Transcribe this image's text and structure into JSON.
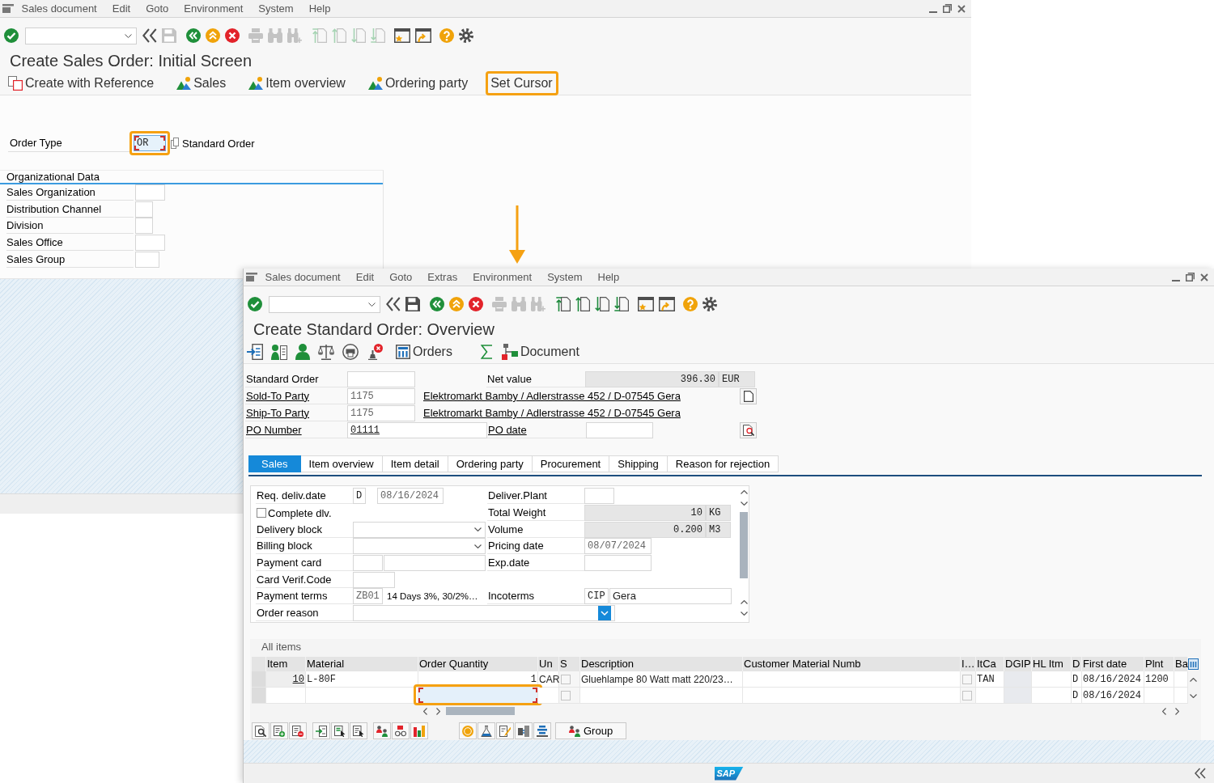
{
  "initial_window": {
    "menu": [
      "Sales document",
      "Edit",
      "Goto",
      "Environment",
      "System",
      "Help"
    ],
    "toolbar": [
      {
        "kind": "enter",
        "disabled": false
      },
      {
        "kind": "collapse",
        "disabled": false
      },
      {
        "kind": "save",
        "disabled": true
      },
      {
        "kind": "back",
        "disabled": false
      },
      {
        "kind": "exit",
        "disabled": false
      },
      {
        "kind": "cancel",
        "disabled": false
      },
      {
        "kind": "print",
        "disabled": true
      },
      {
        "kind": "find",
        "disabled": true
      },
      {
        "kind": "find_next",
        "disabled": true
      },
      {
        "kind": "first_page",
        "disabled": true
      },
      {
        "kind": "previous_page",
        "disabled": true
      },
      {
        "kind": "next_page",
        "disabled": true
      },
      {
        "kind": "last_page",
        "disabled": true
      },
      {
        "kind": "new_session",
        "disabled": false
      },
      {
        "kind": "shortcut",
        "disabled": false
      },
      {
        "kind": "help",
        "disabled": false
      },
      {
        "kind": "settings",
        "disabled": false
      }
    ],
    "title": "Create Sales Order: Initial Screen",
    "app_toolbar": [
      {
        "kind": "reference",
        "label": "Create with Reference",
        "highlighted": false
      },
      {
        "kind": "screen",
        "label": "Sales",
        "highlighted": false
      },
      {
        "kind": "screen",
        "label": "Item overview",
        "highlighted": false
      },
      {
        "kind": "screen",
        "label": "Ordering party",
        "highlighted": false
      },
      {
        "kind": "text",
        "label": "Set Cursor",
        "highlighted": true
      }
    ],
    "order_type": {
      "label": "Order Type",
      "value": "OR",
      "focused": true,
      "highlighted": true,
      "description": "Standard Order"
    },
    "org_data": {
      "title": "Organizational Data",
      "fields": [
        {
          "label": "Sales Organization"
        },
        {
          "label": "Distribution Channel"
        },
        {
          "label": "Division"
        },
        {
          "label": "Sales Office"
        },
        {
          "label": "Sales Group"
        }
      ]
    }
  },
  "overview_window": {
    "menu": [
      "Sales document",
      "Edit",
      "Goto",
      "Extras",
      "Environment",
      "System",
      "Help"
    ],
    "toolbar": [
      {
        "kind": "enter",
        "disabled": false
      },
      {
        "kind": "collapse",
        "disabled": false
      },
      {
        "kind": "save",
        "disabled": false
      },
      {
        "kind": "back",
        "disabled": false
      },
      {
        "kind": "exit",
        "disabled": false
      },
      {
        "kind": "cancel",
        "disabled": false
      },
      {
        "kind": "print",
        "disabled": true
      },
      {
        "kind": "find",
        "disabled": true
      },
      {
        "kind": "find_next",
        "disabled": true
      },
      {
        "kind": "first_page",
        "disabled": false
      },
      {
        "kind": "previous_page",
        "disabled": false
      },
      {
        "kind": "next_page",
        "disabled": false
      },
      {
        "kind": "last_page",
        "disabled": false
      },
      {
        "kind": "new_session",
        "disabled": false
      },
      {
        "kind": "shortcut",
        "disabled": false
      },
      {
        "kind": "help",
        "disabled": false
      },
      {
        "kind": "settings",
        "disabled": false
      }
    ],
    "title": "Create Standard Order: Overview",
    "app_toolbar": [
      {
        "kind": "header"
      },
      {
        "kind": "partner_list"
      },
      {
        "kind": "person"
      },
      {
        "kind": "scale"
      },
      {
        "kind": "print_preview"
      },
      {
        "kind": "stamp_cancel"
      },
      {
        "kind": "table",
        "label": "Orders"
      },
      {
        "kind": "sigma"
      },
      {
        "kind": "flow",
        "label": "Document"
      }
    ],
    "header": {
      "order": {
        "label": "Standard Order"
      },
      "net_value": {
        "label": "Net value",
        "value": "396.30",
        "currency": "EUR"
      },
      "parties": [
        {
          "label": "Sold-To Party",
          "number": "1175",
          "address": "Elektromarkt Bamby / Adlerstrasse 452 / D-07545 Gera"
        },
        {
          "label": "Ship-To Party",
          "number": "1175",
          "address": "Elektromarkt Bamby / Adlerstrasse 452 / D-07545 Gera"
        }
      ],
      "po_number": {
        "label": "PO Number",
        "value": "01111"
      },
      "po_date": {
        "label": "PO date"
      }
    },
    "tabs": [
      {
        "label": "Sales",
        "selected": true
      },
      {
        "label": "Item overview",
        "selected": false
      },
      {
        "label": "Item detail",
        "selected": false
      },
      {
        "label": "Ordering party",
        "selected": false
      },
      {
        "label": "Procurement",
        "selected": false
      },
      {
        "label": "Shipping",
        "selected": false
      },
      {
        "label": "Reason for rejection",
        "selected": false
      }
    ],
    "sales_tab": {
      "rows": [
        {
          "left": {
            "kind": "date",
            "label": "Req. deliv.date",
            "code": "D",
            "value": "08/16/2024"
          },
          "right": {
            "kind": "input",
            "label": "Deliver.Plant"
          }
        },
        {
          "left": {
            "kind": "checkbox",
            "label": "Complete dlv.",
            "checked": false
          },
          "right": {
            "kind": "quantity",
            "label": "Total Weight",
            "value": "10",
            "unit": "KG"
          }
        },
        {
          "left": {
            "kind": "dropdown",
            "label": "Delivery block",
            "focused": false
          },
          "right": {
            "kind": "quantity",
            "label": "Volume",
            "value": "0.200",
            "unit": "M3"
          }
        },
        {
          "left": {
            "kind": "dropdown",
            "label": "Billing block",
            "focused": false
          },
          "right": {
            "kind": "input",
            "label": "Pricing date",
            "value": "08/07/2024"
          }
        },
        {
          "left": {
            "kind": "pair",
            "label": "Payment card"
          },
          "right": {
            "kind": "input",
            "label": "Exp.date"
          }
        },
        {
          "left": {
            "kind": "input",
            "label": "Card Verif.Code"
          }
        },
        {
          "left": {
            "kind": "code_text",
            "label": "Payment terms",
            "code": "ZB01",
            "text": "14 Days 3%, 30/2%…"
          },
          "right": {
            "kind": "pair",
            "label": "Incoterms",
            "values": [
              "CIP",
              "Gera"
            ]
          }
        },
        {
          "left": {
            "kind": "dropdown",
            "label": "Order reason",
            "focused": true
          }
        }
      ]
    },
    "items": {
      "title": "All items",
      "columns": [
        "Item",
        "Material",
        "Order Quantity",
        "Un",
        "S",
        "Description",
        "Customer Material Numb",
        "I…",
        "ItCa",
        "DGIP",
        "HL Itm",
        "D",
        "First date",
        "Plnt",
        "Ba"
      ],
      "rows": [
        {
          "item": "10",
          "material": "L-80F",
          "quantity": "1",
          "quantity_focused": false,
          "quantity_highlighted": false,
          "unit": "CAR",
          "s_checked": false,
          "description": "Gluehlampe 80 Watt matt 220/23…",
          "i_checked": false,
          "item_category": "TAN",
          "date_type": "D",
          "first_date": "08/16/2024",
          "plant": "1200"
        },
        {
          "quantity_focused": true,
          "quantity_highlighted": true,
          "s_checked": false,
          "i_checked": false,
          "date_type": "D",
          "first_date": "08/16/2024"
        }
      ]
    },
    "table_toolbar": [
      {
        "kind": "doc_search"
      },
      {
        "kind": "row_add"
      },
      {
        "kind": "row_remove"
      },
      {
        "kind": "list_arrow"
      },
      {
        "kind": "list_select"
      },
      {
        "kind": "list_cursor"
      },
      {
        "kind": "partners"
      },
      {
        "kind": "glasses"
      },
      {
        "kind": "chart"
      },
      {
        "kind": "coin"
      },
      {
        "kind": "flask"
      },
      {
        "kind": "notes"
      },
      {
        "kind": "device"
      },
      {
        "kind": "stack"
      },
      {
        "kind": "group",
        "label": "Group"
      }
    ],
    "status_bar": {
      "logo": "SAP"
    }
  }
}
